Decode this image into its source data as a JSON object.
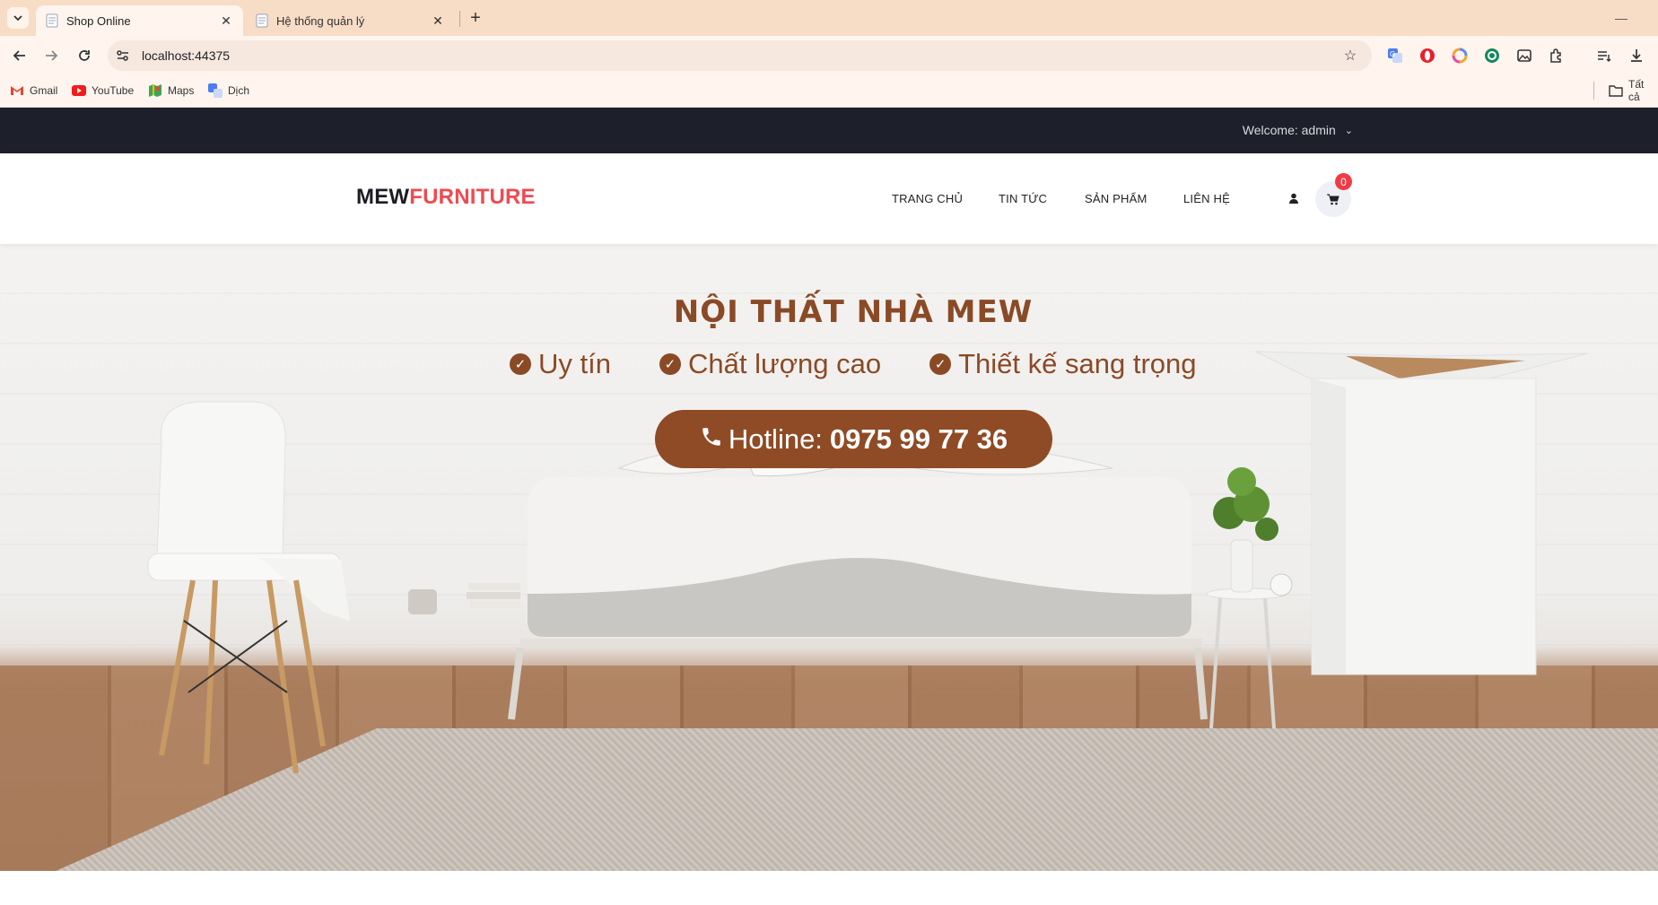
{
  "browser": {
    "tabs": [
      {
        "title": "Shop Online",
        "active": true
      },
      {
        "title": "Hệ thống quản lý",
        "active": false
      }
    ],
    "url": "localhost:44375",
    "bookmarks": [
      {
        "label": "Gmail",
        "icon": "gmail-icon"
      },
      {
        "label": "YouTube",
        "icon": "youtube-icon"
      },
      {
        "label": "Maps",
        "icon": "maps-icon"
      },
      {
        "label": "Dịch",
        "icon": "translate-icon"
      }
    ],
    "all_bookmarks_label": "Tất cả"
  },
  "site": {
    "welcome": "Welcome: admin",
    "logo": {
      "part1": "MEW",
      "part2": "FURNITURE"
    },
    "nav": [
      "TRANG CHỦ",
      "TIN TỨC",
      "SẢN PHẨM",
      "LIÊN HỆ"
    ],
    "cart_count": "0",
    "hero": {
      "title": "NỘI THẤT NHÀ MEW",
      "features": [
        "Uy tín",
        "Chất lượng cao",
        "Thiết kế sang trọng"
      ],
      "hotline_label": "Hotline:",
      "hotline_number": "0975 99 77 36"
    }
  },
  "colors": {
    "brand_red": "#ef4a50",
    "brown_accent": "#8f4b25",
    "topbar": "#1d1f2b"
  }
}
